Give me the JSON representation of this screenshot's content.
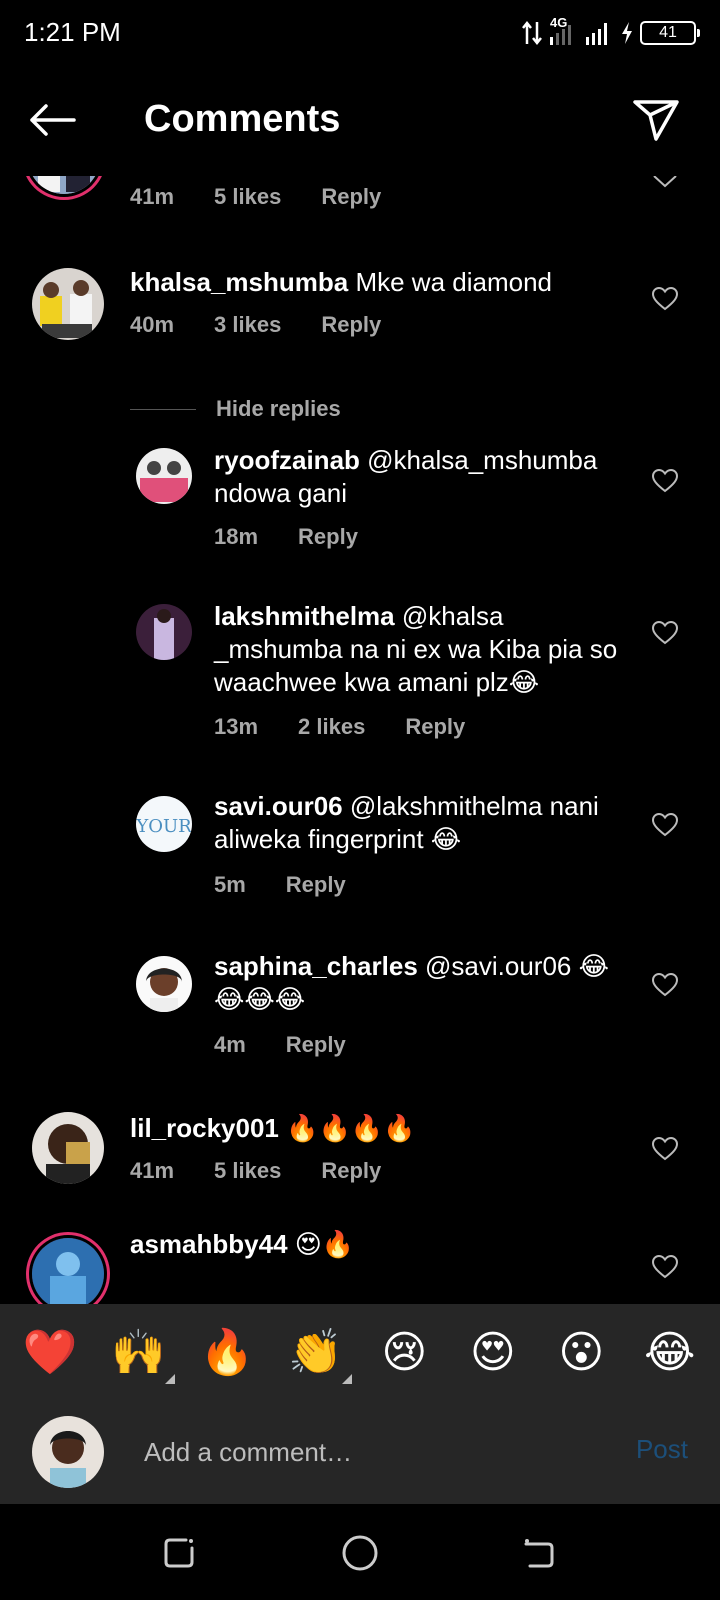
{
  "status": {
    "time": "1:21 PM",
    "network": "4G",
    "battery": "41"
  },
  "header": {
    "title": "Comments"
  },
  "comments": [
    {
      "meta": {
        "time": "41m",
        "likes": "5 likes",
        "reply": "Reply"
      }
    },
    {
      "user": "khalsa_mshumba",
      "text": "Mke wa diamond",
      "meta": {
        "time": "40m",
        "likes": "3 likes",
        "reply": "Reply"
      }
    },
    {
      "hide_replies": "Hide replies"
    },
    {
      "user": "ryoofzainab",
      "text": "@khalsa_mshumba ndowa gani",
      "meta": {
        "time": "18m",
        "reply": "Reply"
      }
    },
    {
      "user": "lakshmithelma",
      "text": "@khalsa _mshumba na ni ex wa Kiba pia so waachwee kwa amani plz😂",
      "meta": {
        "time": "13m",
        "likes": "2 likes",
        "reply": "Reply"
      }
    },
    {
      "user": "savi.our06",
      "text": "@lakshmithelma nani aliweka fingerprint 😂",
      "meta": {
        "time": "5m",
        "reply": "Reply"
      }
    },
    {
      "user": "saphina_charles",
      "text": "@savi.our06 😂😂😂😂",
      "meta": {
        "time": "4m",
        "reply": "Reply"
      }
    },
    {
      "user": "lil_rocky001",
      "text": "🔥🔥🔥🔥",
      "meta": {
        "time": "41m",
        "likes": "5 likes",
        "reply": "Reply"
      }
    },
    {
      "user": "asmahbby44",
      "text": "😍🔥"
    }
  ],
  "reactions": [
    "❤️",
    "🙌",
    "🔥",
    "👏",
    "😢",
    "😍",
    "😮",
    "😂"
  ],
  "composer": {
    "placeholder": "Add a comment…",
    "post": "Post"
  },
  "colors": {
    "background": "#000000",
    "muted": "#a8a8a8",
    "panel": "#262626",
    "post_disabled": "#1c4f7a",
    "story_ring": "#e1306c"
  }
}
